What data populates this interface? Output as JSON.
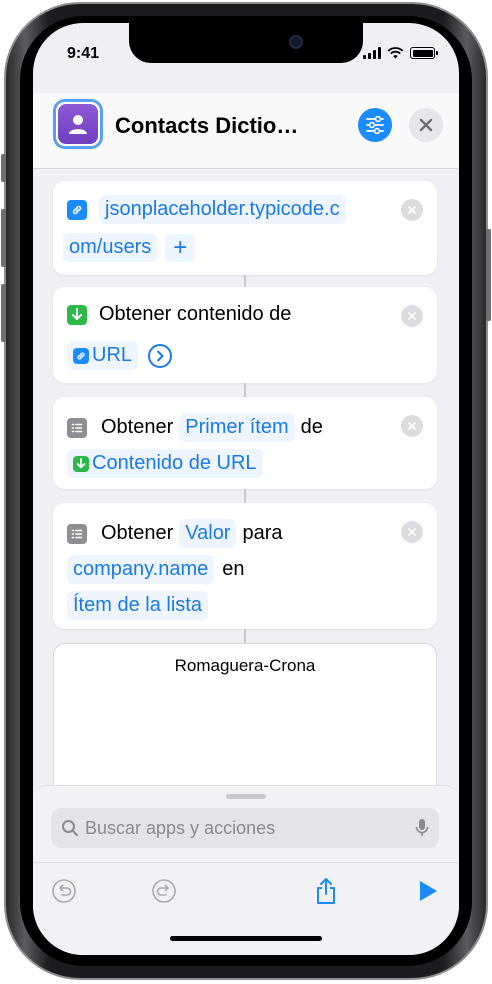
{
  "status_bar": {
    "time": "9:41",
    "battery_level": 1.0
  },
  "header": {
    "title": "Contacts Dictio…",
    "app_icon": "person-icon",
    "settings_icon": "sliders-icon",
    "close_icon": "close-icon"
  },
  "actions": [
    {
      "type": "url",
      "icon": "link-icon",
      "line1_token": "jsonplaceholder.typicode.c",
      "line2_token": "om/users",
      "add_label": "+"
    },
    {
      "type": "get_contents",
      "icon": "download-icon",
      "label": "Obtener contenido de",
      "token": "URL",
      "token_icon": "link-icon"
    },
    {
      "type": "get_item",
      "icon": "list-icon",
      "label_pre": "Obtener",
      "token_item": "Primer ítem",
      "label_mid": "de",
      "token_source": "Contenido de URL",
      "token_source_icon": "download-icon"
    },
    {
      "type": "get_value",
      "icon": "list-icon",
      "label_pre": "Obtener",
      "token_value": "Valor",
      "label_para": "para",
      "token_key": "company.name",
      "label_en": "en",
      "token_source": "Ítem de la lista"
    }
  ],
  "result": {
    "text": "Romaguera-Crona"
  },
  "bottom_sheet": {
    "search_placeholder": "Buscar apps y acciones",
    "search_icon": "search-icon",
    "mic_icon": "microphone-icon",
    "toolbar": {
      "undo_icon": "undo-icon",
      "redo_icon": "redo-icon",
      "share_icon": "share-icon",
      "run_icon": "play-icon"
    }
  },
  "colors": {
    "accent": "#1a8cff",
    "token_text": "#1a7ae8",
    "token_bg": "#eef5ff",
    "app_purple": "#7a48cc",
    "green_action": "#2fb84a",
    "background": "#efeff4"
  }
}
